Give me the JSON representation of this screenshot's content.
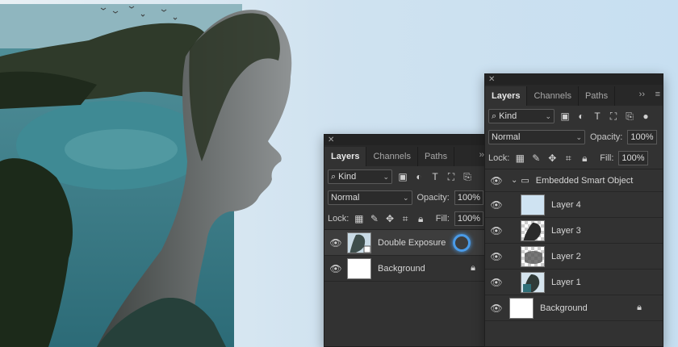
{
  "colors": {
    "accent_ring": "#4a9be8",
    "panel_bg": "#323232",
    "sky": "#dbe8f2"
  },
  "panel_small": {
    "tabs": [
      "Layers",
      "Channels",
      "Paths"
    ],
    "filter_label": "Kind",
    "blend_mode": "Normal",
    "opacity_label": "Opacity:",
    "opacity_value": "100%",
    "lock_label": "Lock:",
    "fill_label": "Fill:",
    "fill_value": "100%",
    "layers": [
      {
        "name": "Double Exposure",
        "icon": "smart-object-thumbnail"
      },
      {
        "name": "Background",
        "icon": "white-thumbnail",
        "locked": true
      }
    ]
  },
  "panel_large": {
    "tabs": [
      "Layers",
      "Channels",
      "Paths"
    ],
    "filter_label": "Kind",
    "blend_mode": "Normal",
    "opacity_label": "Opacity:",
    "opacity_value": "100%",
    "lock_label": "Lock:",
    "fill_label": "Fill:",
    "fill_value": "100%",
    "group_name": "Embedded Smart Object",
    "layers": [
      {
        "name": "Layer 4"
      },
      {
        "name": "Layer 3"
      },
      {
        "name": "Layer 2"
      },
      {
        "name": "Layer 1"
      },
      {
        "name": "Background",
        "locked": true
      }
    ]
  }
}
